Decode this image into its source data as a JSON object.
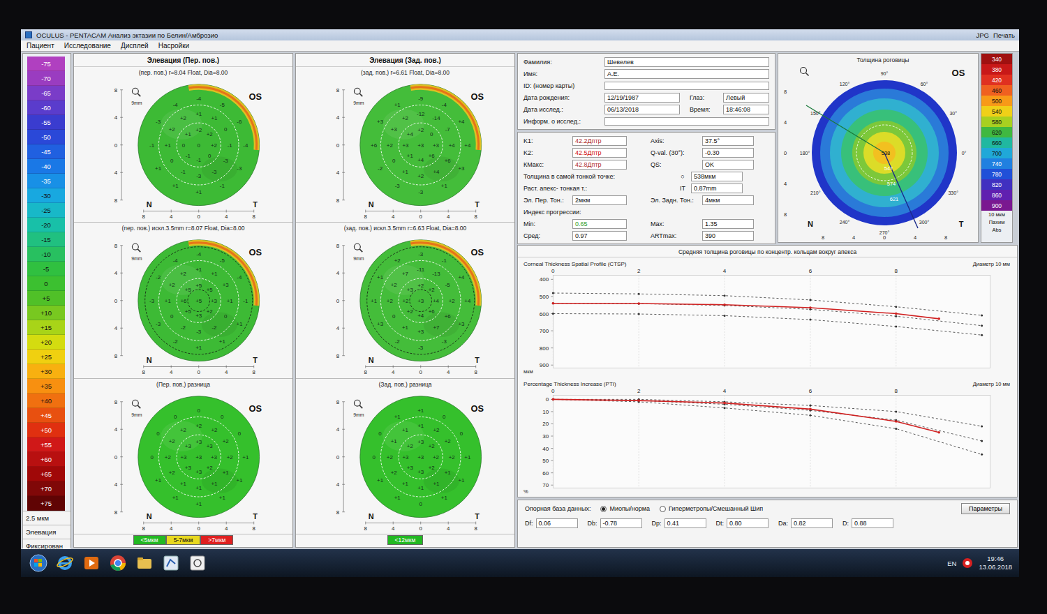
{
  "window": {
    "title": "OCULUS - PENTACAM  Анализ эктазии по Белин/Амброзио",
    "right_buttons": [
      "JPG",
      "Печать"
    ]
  },
  "menu": [
    "Пациент",
    "Исследование",
    "Дисплей",
    "Насройки"
  ],
  "elevation_scale": {
    "items": [
      {
        "label": "-75",
        "color": "#b040c0"
      },
      {
        "label": "-70",
        "color": "#9a3cc0"
      },
      {
        "label": "-65",
        "color": "#7a3cc8"
      },
      {
        "label": "-60",
        "color": "#5a3ccc"
      },
      {
        "label": "-55",
        "color": "#3a3ccf"
      },
      {
        "label": "-50",
        "color": "#2a48d8"
      },
      {
        "label": "-45",
        "color": "#2060e0"
      },
      {
        "label": "-40",
        "color": "#1a78e6"
      },
      {
        "label": "-35",
        "color": "#1890e6"
      },
      {
        "label": "-30",
        "color": "#18a8e0"
      },
      {
        "label": "-25",
        "color": "#18b8c8"
      },
      {
        "label": "-20",
        "color": "#18c0a8"
      },
      {
        "label": "-15",
        "color": "#20c080"
      },
      {
        "label": "-10",
        "color": "#28c060"
      },
      {
        "label": "-5",
        "color": "#30c040"
      },
      {
        "label": "0",
        "color": "#3cc030"
      },
      {
        "label": "+5",
        "color": "#50c028"
      },
      {
        "label": "+10",
        "color": "#78c820"
      },
      {
        "label": "+15",
        "color": "#a8d418"
      },
      {
        "label": "+20",
        "color": "#d4dc10"
      },
      {
        "label": "+25",
        "color": "#f0d010"
      },
      {
        "label": "+30",
        "color": "#f8b010"
      },
      {
        "label": "+35",
        "color": "#f89010"
      },
      {
        "label": "+40",
        "color": "#f07010"
      },
      {
        "label": "+45",
        "color": "#e85010"
      },
      {
        "label": "+50",
        "color": "#e03010"
      },
      {
        "label": "+55",
        "color": "#d01818"
      },
      {
        "label": "+60",
        "color": "#b81010"
      },
      {
        "label": "+65",
        "color": "#a00808"
      },
      {
        "label": "+70",
        "color": "#800808"
      },
      {
        "label": "+75",
        "color": "#600404"
      }
    ],
    "unit": "2.5 мкм",
    "mode": "Элевация",
    "fixed": "Фиксирован"
  },
  "maps": {
    "ticks": [
      "8",
      "4",
      "0",
      "4",
      "8"
    ],
    "eye": "OS",
    "nasal": "N",
    "temporal": "T",
    "zoom": "9mm",
    "columns": [
      {
        "title": "Элевация (Пер. пов.)",
        "items": [
          {
            "subtitle": "(пер. пов.) r=8.04 Float, Dia=8.00",
            "kind": "elevation",
            "color": "#3dba35",
            "values": [
              "0",
              "+2",
              "+2",
              "+2",
              "0",
              "-1",
              "-1",
              "0",
              "+1",
              "+1",
              "+1",
              "0",
              "-1",
              "-3",
              "-3",
              "-3",
              "-1",
              "0",
              "+1",
              "+2",
              "+2",
              "-4",
              "-5",
              "-6",
              "-4",
              "-3",
              "-1",
              "+1",
              "+1",
              "+1",
              "-1",
              "-3",
              "-4"
            ]
          },
          {
            "subtitle": "(пер. пов.) искл.3.5mm r=8.07 Float, Dia=8.00",
            "kind": "excluded",
            "color": "#3dba35",
            "values": [
              "+5",
              "+5",
              "+5",
              "+3",
              "+2",
              "+3",
              "+5",
              "+6",
              "+5",
              "+1",
              "+1",
              "+3",
              "+1",
              "0",
              "-2",
              "-3",
              "-2",
              "0",
              "+1",
              "+2",
              "+2",
              "-4",
              "-5",
              "-4",
              "-1",
              "+1",
              "+1",
              "+1",
              "-2",
              "-3",
              "-3",
              "-2",
              "-4"
            ]
          },
          {
            "subtitle": "(Пер. пов.) разница",
            "kind": "difference",
            "color": "#35c02c",
            "values": [
              "+3",
              "+3",
              "+3",
              "+3",
              "+2",
              "+3",
              "+3",
              "+3",
              "+3",
              "+2",
              "+2",
              "+2",
              "+2",
              "+1",
              "+1",
              "+1",
              "+1",
              "+2",
              "+2",
              "+2",
              "+2",
              "0",
              "0",
              "0",
              "+1",
              "+1",
              "+1",
              "+1",
              "+1",
              "+1",
              "0",
              "0",
              "0"
            ]
          }
        ],
        "legend": [
          {
            "label": "<5мкм",
            "color": "#22b822"
          },
          {
            "label": "5-7мкм",
            "color": "#e8d820"
          },
          {
            "label": ">7мкм",
            "color": "#e02020"
          }
        ]
      },
      {
        "title": "Элевация (Зад. пов.)",
        "items": [
          {
            "subtitle": "(зад. пов.) r=6.61 Float, Dia=8.00",
            "kind": "elevation",
            "color": "#44bd3a",
            "values": [
              "+3",
              "+2",
              "0",
              "+3",
              "+6",
              "+4",
              "+1",
              "+3",
              "+4",
              "-12",
              "-14",
              "-7",
              "+4",
              "+6",
              "+4",
              "+2",
              "+1",
              "0",
              "+2",
              "+3",
              "+2",
              "-9",
              "-4",
              "+4",
              "+4",
              "+3",
              "+1",
              "-3",
              "-3",
              "-2",
              "+6",
              "+3",
              "+1"
            ]
          },
          {
            "subtitle": "(зад. пов.) искл.3.5mm r=6.63 Float, Dia=8.00",
            "kind": "excluded",
            "color": "#44bd3a",
            "values": [
              "+3",
              "+2",
              "+2",
              "+4",
              "+6",
              "+4",
              "+2",
              "+2",
              "+3",
              "-11",
              "-13",
              "-5",
              "+2",
              "+6",
              "+7",
              "+3",
              "+1",
              "0",
              "+2",
              "+2",
              "+7",
              "-3",
              "-1",
              "+4",
              "+4",
              "+3",
              "-3",
              "-3",
              "-2",
              "+3",
              "+1",
              "+1",
              "+2"
            ]
          },
          {
            "subtitle": "(Зад. пов.) разница",
            "kind": "difference",
            "color": "#35c02c",
            "values": [
              "+3",
              "+3",
              "+2",
              "+2",
              "+2",
              "+3",
              "+3",
              "+3",
              "+2",
              "+1",
              "+2",
              "+2",
              "+2",
              "+1",
              "+1",
              "+1",
              "+1",
              "+2",
              "+2",
              "+1",
              "+1",
              "+1",
              "0",
              "0",
              "+1",
              "+1",
              "+1",
              "0",
              "+1",
              "+1",
              "0",
              "0",
              "+1"
            ]
          }
        ],
        "legend": [
          {
            "label": "<12мкм",
            "color": "#22b822"
          }
        ]
      }
    ]
  },
  "patient": {
    "fields": [
      {
        "label": "Фамилия:",
        "value": "Шевелев"
      },
      {
        "label": "Имя:",
        "value": "А.Е."
      },
      {
        "label": "ID: (номер карты)",
        "value": ""
      },
      {
        "label": "Дата рождения:",
        "value": "12/19/1987",
        "label2": "Глаз:",
        "value2": "Левый"
      },
      {
        "label": "Дата исслед.:",
        "value": "06/13/2018",
        "label2": "Время:",
        "value2": "18:46:08"
      },
      {
        "label": "Информ. о исслед.:",
        "value": ""
      }
    ]
  },
  "keratometry": {
    "rows": [
      {
        "label": "K1:",
        "value": "42.2Дптр",
        "color": "#b03030",
        "label2": "Axis:",
        "value2": "37.5°"
      },
      {
        "label": "K2:",
        "value": "42.5Дптр",
        "color": "#d01010",
        "label2": "Q-val. (30°):",
        "value2": "-0.30"
      },
      {
        "label": "КМакс:",
        "value": "42.8Дптр",
        "color": "#b03030",
        "label2": "QS:",
        "value2": "OK"
      }
    ],
    "thinnest": {
      "label": "Толщина в самой тонкой точке:",
      "symbol": "○",
      "value": "538мкм"
    },
    "apex": {
      "label": "Раст. апекс- тонкая т.:",
      "symbol": "IT",
      "value": "0.87mm"
    },
    "elevation": {
      "label": "Эл. Пер. Тон.:",
      "value": "2мкм",
      "label2": "Эл. Задн. Тон.:",
      "value2": "4мкм"
    },
    "progression": {
      "title": "Индекс прогрессии:",
      "rows": [
        {
          "label": "Min:",
          "value": "0.65",
          "color": "#2e9e2e",
          "label2": "Max:",
          "value2": "1.35"
        },
        {
          "label": "Сред:",
          "value": "0.97",
          "color": "#1a1a1a",
          "label2": "ARTmax:",
          "value2": "390"
        }
      ]
    }
  },
  "thickness_map": {
    "title": "Толщина роговицы",
    "eye": "OS",
    "nasal": "N",
    "temporal": "T",
    "ticks": [
      "8",
      "4",
      "0",
      "4",
      "8"
    ],
    "angles": [
      "0°",
      "30°",
      "60°",
      "90°",
      "120°",
      "150°",
      "180°",
      "210°",
      "240°",
      "270°",
      "300°",
      "330°"
    ],
    "values": [
      "538",
      "547",
      "574",
      "621"
    ],
    "scale": [
      {
        "label": "340",
        "color": "#a01010"
      },
      {
        "label": "380",
        "color": "#c81818"
      },
      {
        "label": "420",
        "color": "#e03020"
      },
      {
        "label": "460",
        "color": "#f06020"
      },
      {
        "label": "500",
        "color": "#f89a18"
      },
      {
        "label": "540",
        "color": "#f0d018"
      },
      {
        "label": "580",
        "color": "#a8d020"
      },
      {
        "label": "620",
        "color": "#40b840"
      },
      {
        "label": "660",
        "color": "#20b8a0"
      },
      {
        "label": "700",
        "color": "#20a8d8"
      },
      {
        "label": "740",
        "color": "#2080e0"
      },
      {
        "label": "780",
        "color": "#2050d8"
      },
      {
        "label": "820",
        "color": "#4030c0"
      },
      {
        "label": "860",
        "color": "#6020b0"
      },
      {
        "label": "900",
        "color": "#7a1890"
      }
    ],
    "scale_footer": [
      "10 мкм",
      "Пахим",
      "Abs"
    ]
  },
  "charts": {
    "title": "Средняя толщина роговицы по концентр. кольцам вокруг апекса",
    "x_ticks": [
      "0",
      "2",
      "4",
      "6",
      "8"
    ],
    "x_label": "Диаметр 10 мм",
    "ctsp": {
      "title": "Corneal Thickness Spatial Profile (CTSP)",
      "y_ticks": [
        "400",
        "500",
        "600",
        "700",
        "800",
        "900"
      ],
      "unit": "мкм",
      "series": [
        {
          "kind": "norm",
          "color": "#333333",
          "x": [
            0,
            2,
            4,
            6,
            8,
            10
          ],
          "values": [
            480,
            485,
            495,
            520,
            560,
            610
          ]
        },
        {
          "kind": "norm",
          "color": "#333333",
          "x": [
            0,
            2,
            4,
            6,
            8,
            10
          ],
          "values": [
            540,
            542,
            552,
            575,
            615,
            670
          ]
        },
        {
          "kind": "norm",
          "color": "#333333",
          "x": [
            0,
            2,
            4,
            6,
            8,
            10
          ],
          "values": [
            600,
            602,
            612,
            635,
            675,
            725
          ]
        },
        {
          "kind": "patient",
          "color": "#d02020",
          "x": [
            0,
            2,
            4,
            6,
            8,
            9
          ],
          "values": [
            540,
            541,
            548,
            565,
            600,
            630
          ]
        }
      ]
    },
    "pti": {
      "title": "Percentage Thickness Increase (PTI)",
      "y_ticks": [
        "0",
        "10",
        "20",
        "30",
        "40",
        "50",
        "60",
        "70"
      ],
      "unit": "%",
      "series": [
        {
          "kind": "norm",
          "color": "#333333",
          "x": [
            0,
            2,
            4,
            6,
            8,
            10
          ],
          "values": [
            0,
            0,
            2,
            5,
            10,
            22
          ]
        },
        {
          "kind": "norm",
          "color": "#333333",
          "x": [
            0,
            2,
            4,
            6,
            8,
            10
          ],
          "values": [
            0,
            1,
            4,
            9,
            17,
            34
          ]
        },
        {
          "kind": "norm",
          "color": "#333333",
          "x": [
            0,
            2,
            4,
            6,
            8,
            10
          ],
          "values": [
            0,
            2,
            7,
            13,
            24,
            45
          ]
        },
        {
          "kind": "patient",
          "color": "#d02020",
          "x": [
            0,
            2,
            4,
            6,
            8,
            9
          ],
          "values": [
            0,
            1,
            3,
            8,
            18,
            27
          ]
        }
      ]
    }
  },
  "database": {
    "label": "Опорная база данных:",
    "options": [
      {
        "label": "Миопы/норма",
        "selected": true
      },
      {
        "label": "Гиперметропы/Смешанный Шип",
        "selected": false
      }
    ],
    "button": "Параметры",
    "fields": [
      {
        "label": "Df:",
        "value": "0.06"
      },
      {
        "label": "Db:",
        "value": "-0.78"
      },
      {
        "label": "Dp:",
        "value": "0.41"
      },
      {
        "label": "Dt:",
        "value": "0.80"
      },
      {
        "label": "Da:",
        "value": "0.82"
      },
      {
        "label": "D:",
        "value": "0.88"
      }
    ]
  },
  "taskbar": {
    "lang": "EN",
    "time": "19:46",
    "date": "13.06.2018"
  }
}
